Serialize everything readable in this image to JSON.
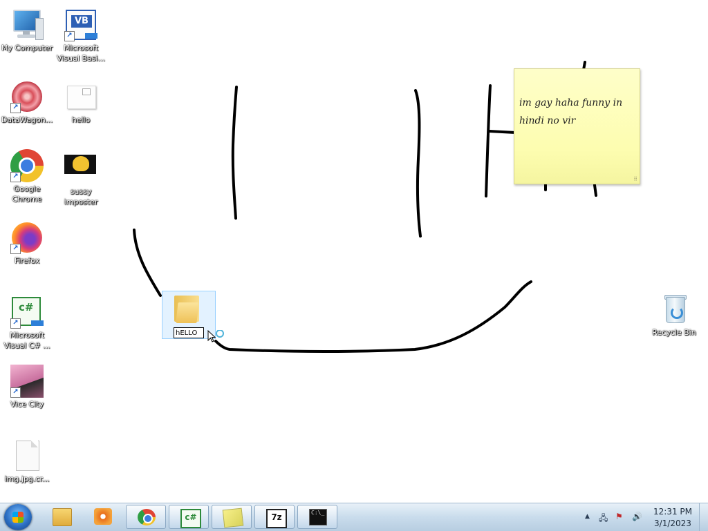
{
  "desktop": {
    "icons": [
      {
        "id": "my-computer",
        "label": "My Computer",
        "icon": "computer-icon"
      },
      {
        "id": "visual-basic",
        "label": "Microsoft Visual Basi...",
        "icon": "visual-basic-icon"
      },
      {
        "id": "datawagon",
        "label": "DataWagon...",
        "icon": "datawagon-icon"
      },
      {
        "id": "hello",
        "label": "hello",
        "icon": "image-file-icon"
      },
      {
        "id": "google-chrome",
        "label": "Google Chrome",
        "icon": "chrome-icon"
      },
      {
        "id": "sussy-imposter",
        "label": "sussy imposter",
        "icon": "image-file-icon"
      },
      {
        "id": "firefox",
        "label": "Firefox",
        "icon": "firefox-icon"
      },
      {
        "id": "visual-csharp",
        "label": "Microsoft Visual C# ...",
        "icon": "visual-csharp-icon"
      },
      {
        "id": "vice-city",
        "label": "Vice City",
        "icon": "vice-city-icon"
      },
      {
        "id": "imgjpg",
        "label": "img.jpg.cr...",
        "icon": "blank-file-icon"
      },
      {
        "id": "recycle-bin",
        "label": "Recycle Bin",
        "icon": "recycle-bin-icon"
      }
    ],
    "rename_item": {
      "value": "hELLO",
      "icon": "folder-icon"
    },
    "sticky_note": {
      "text": "im gay haha funny in hindi no vir"
    }
  },
  "taskbar": {
    "start_label": "Start",
    "buttons": [
      {
        "id": "explorer",
        "icon": "windows-explorer-icon"
      },
      {
        "id": "media-player",
        "icon": "media-player-icon"
      },
      {
        "id": "chrome",
        "icon": "chrome-icon"
      },
      {
        "id": "visual-csharp",
        "icon": "visual-csharp-icon",
        "text": "c#"
      },
      {
        "id": "sticky-notes",
        "icon": "sticky-notes-icon"
      },
      {
        "id": "7zip",
        "icon": "7zip-icon",
        "text": "7z"
      },
      {
        "id": "cmd",
        "icon": "command-prompt-icon",
        "text": "C:\\_"
      }
    ],
    "tray": {
      "show_hidden_icon": "▲",
      "network_icon": "network-icon",
      "action_center_icon": "action-center-icon",
      "volume_icon": "speaker-icon"
    },
    "clock": {
      "time": "12:31 PM",
      "date": "3/1/2023"
    }
  },
  "colors": {
    "taskbar_top": "#e8f1f8",
    "taskbar_bottom": "#b7cde1",
    "sticky_bg": "#fdfdb0",
    "selection": "#cce8ff",
    "ink": "#000000"
  }
}
